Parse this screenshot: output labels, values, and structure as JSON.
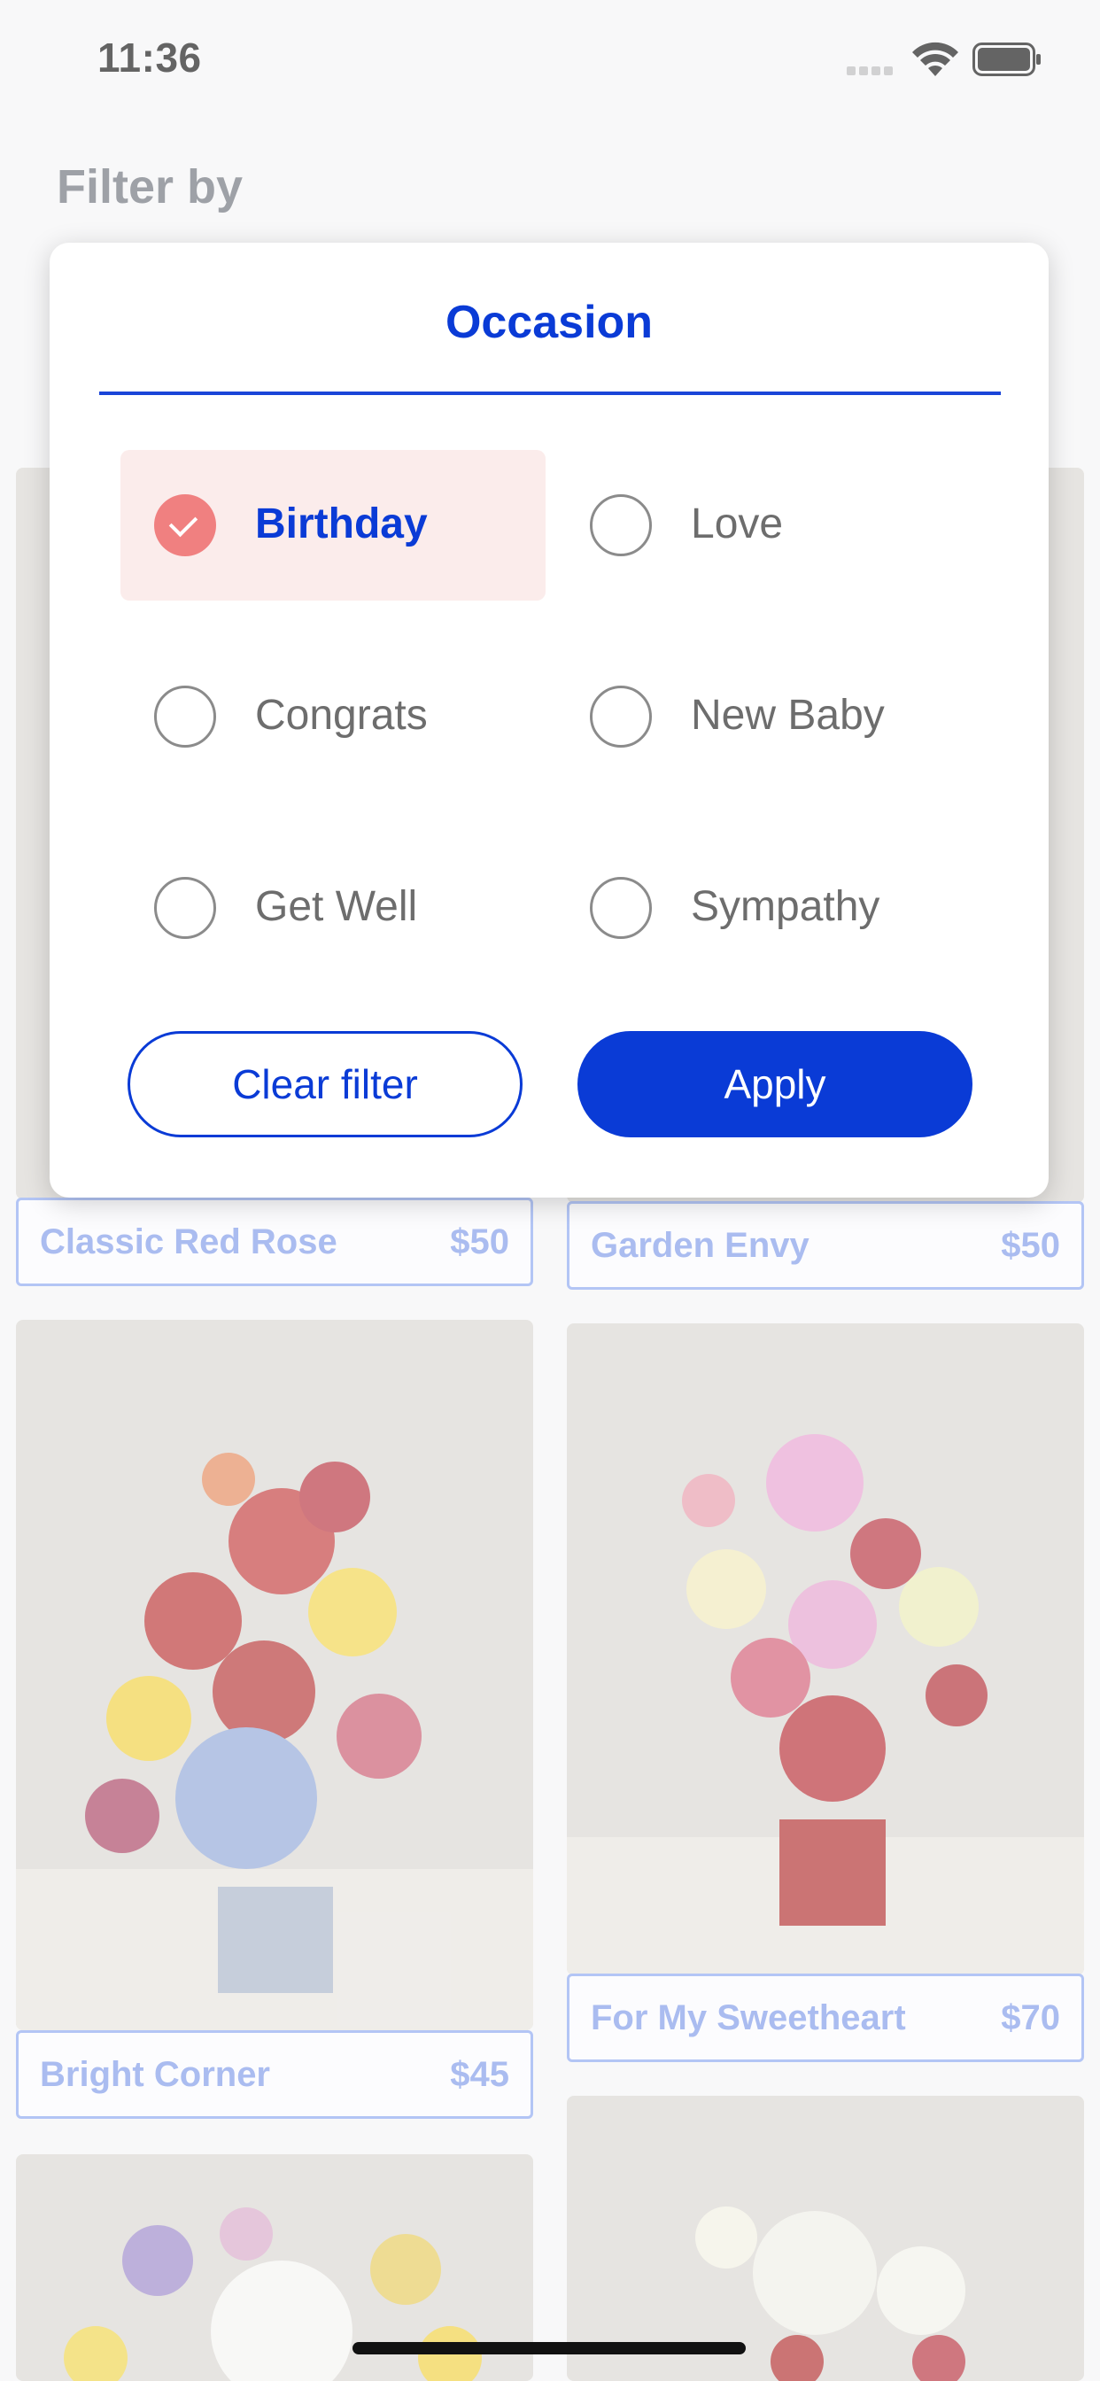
{
  "status_bar": {
    "time": "11:36"
  },
  "page": {
    "title": "Filter by"
  },
  "filter_panel": {
    "tab": "Occasion",
    "options": [
      {
        "label": "Birthday",
        "selected": true
      },
      {
        "label": "Love",
        "selected": false
      },
      {
        "label": "Congrats",
        "selected": false
      },
      {
        "label": "New Baby",
        "selected": false
      },
      {
        "label": "Get Well",
        "selected": false
      },
      {
        "label": "Sympathy",
        "selected": false
      }
    ],
    "clear_label": "Clear filter",
    "apply_label": "Apply"
  },
  "products": [
    {
      "name": "Classic Red Rose",
      "price": "$50"
    },
    {
      "name": "Garden Envy",
      "price": "$50"
    },
    {
      "name": "Bright Corner",
      "price": "$45"
    },
    {
      "name": "For My Sweetheart",
      "price": "$70"
    }
  ],
  "colors": {
    "accent": "#0a3bd6",
    "selected_bg": "#fbeceb",
    "check": "#f08080",
    "product_label": "#7d98e8"
  }
}
